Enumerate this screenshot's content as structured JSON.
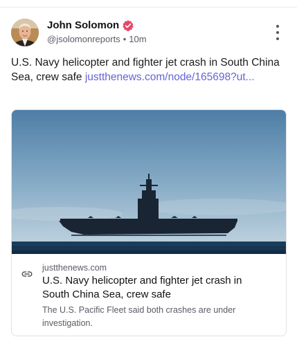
{
  "author": {
    "name": "John Solomon",
    "handle": "@jsolomonreports",
    "separator": "•",
    "time": "10m",
    "verified_icon": "verified-badge-icon",
    "verified_color": "#e8476a"
  },
  "post": {
    "text": "U.S. Navy helicopter and fighter jet crash in South China Sea, crew safe ",
    "link_text": "justthenews.com/node/165698?ut..."
  },
  "card": {
    "image_alt": "Aircraft carrier at sea",
    "domain": "justthenews.com",
    "title": "U.S. Navy helicopter and fighter jet crash in South China Sea, crew safe",
    "description": "The U.S. Pacific Fleet said both crashes are under investigation.",
    "link_icon": "link-icon"
  },
  "menu": {
    "icon": "more-vertical-icon"
  },
  "colors": {
    "link": "#6364d9",
    "muted": "#5b5b66"
  }
}
